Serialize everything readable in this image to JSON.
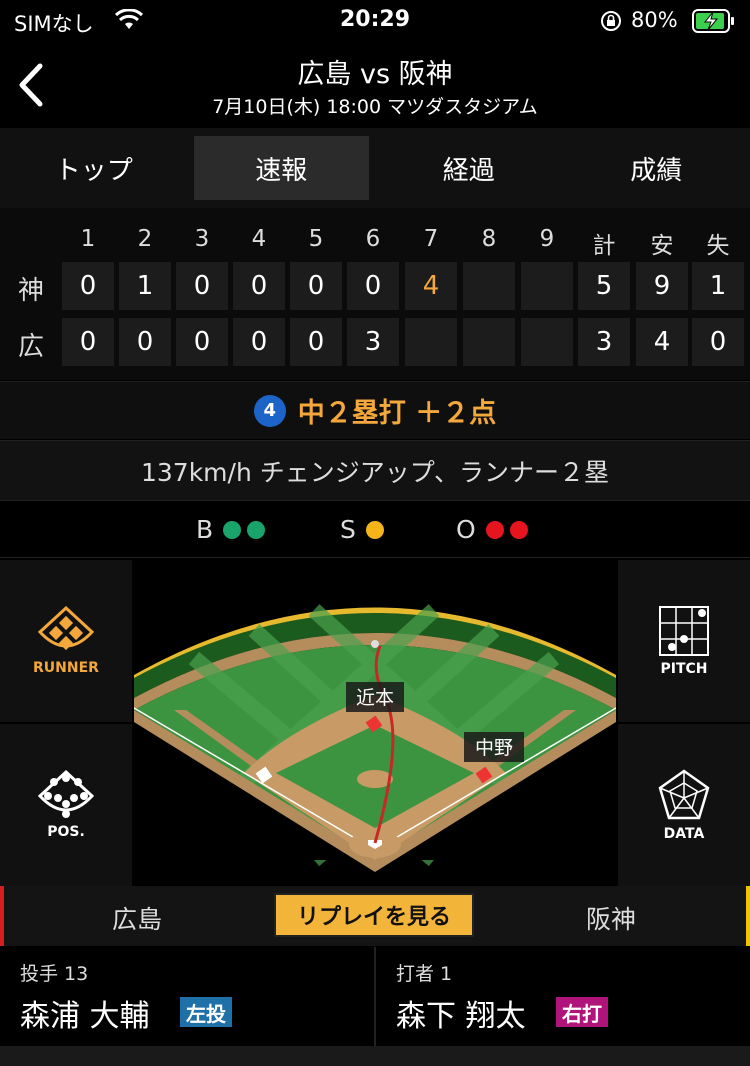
{
  "status": {
    "carrier": "SIMなし",
    "time": "20:29",
    "battery": "80%"
  },
  "header": {
    "title": "広島 vs 阪神",
    "subtitle": "7月10日(木) 18:00 マツダスタジアム"
  },
  "tabs": [
    "トップ",
    "速報",
    "経過",
    "成績"
  ],
  "scoreboard": {
    "headers": [
      "1",
      "2",
      "3",
      "4",
      "5",
      "6",
      "7",
      "8",
      "9",
      "計",
      "安",
      "失"
    ],
    "rows": [
      {
        "team": "神",
        "cells": [
          "0",
          "1",
          "0",
          "0",
          "0",
          "0",
          "4",
          "",
          "",
          "5",
          "9",
          "1"
        ]
      },
      {
        "team": "広",
        "cells": [
          "0",
          "0",
          "0",
          "0",
          "0",
          "3",
          "",
          "",
          "",
          "3",
          "4",
          "0"
        ]
      }
    ]
  },
  "play": {
    "number": "4",
    "text": "中２塁打 ＋２点"
  },
  "pitch_info": "137km/h チェンジアップ、ランナー２塁",
  "count": {
    "b": "B",
    "s": "S",
    "o": "O",
    "balls": 2,
    "strikes": 1,
    "outs": 2
  },
  "colors": {
    "ball": "#1aa36a",
    "strike": "#f4b41a",
    "out": "#e6141e",
    "accent": "#f4a73a"
  },
  "side_buttons": {
    "runner": "RUNNER",
    "pos": "POS.",
    "pitch": "PITCH",
    "data": "DATA"
  },
  "field_labels": {
    "fielder1": "近本",
    "fielder2": "中野"
  },
  "teambar": {
    "home": "広島",
    "replay": "リプレイを見る",
    "away": "阪神"
  },
  "pitcher": {
    "role": "投手 13",
    "name": "森浦 大輔",
    "tag": "左投"
  },
  "batter": {
    "role": "打者 1",
    "name": "森下 翔太",
    "tag": "右打"
  }
}
